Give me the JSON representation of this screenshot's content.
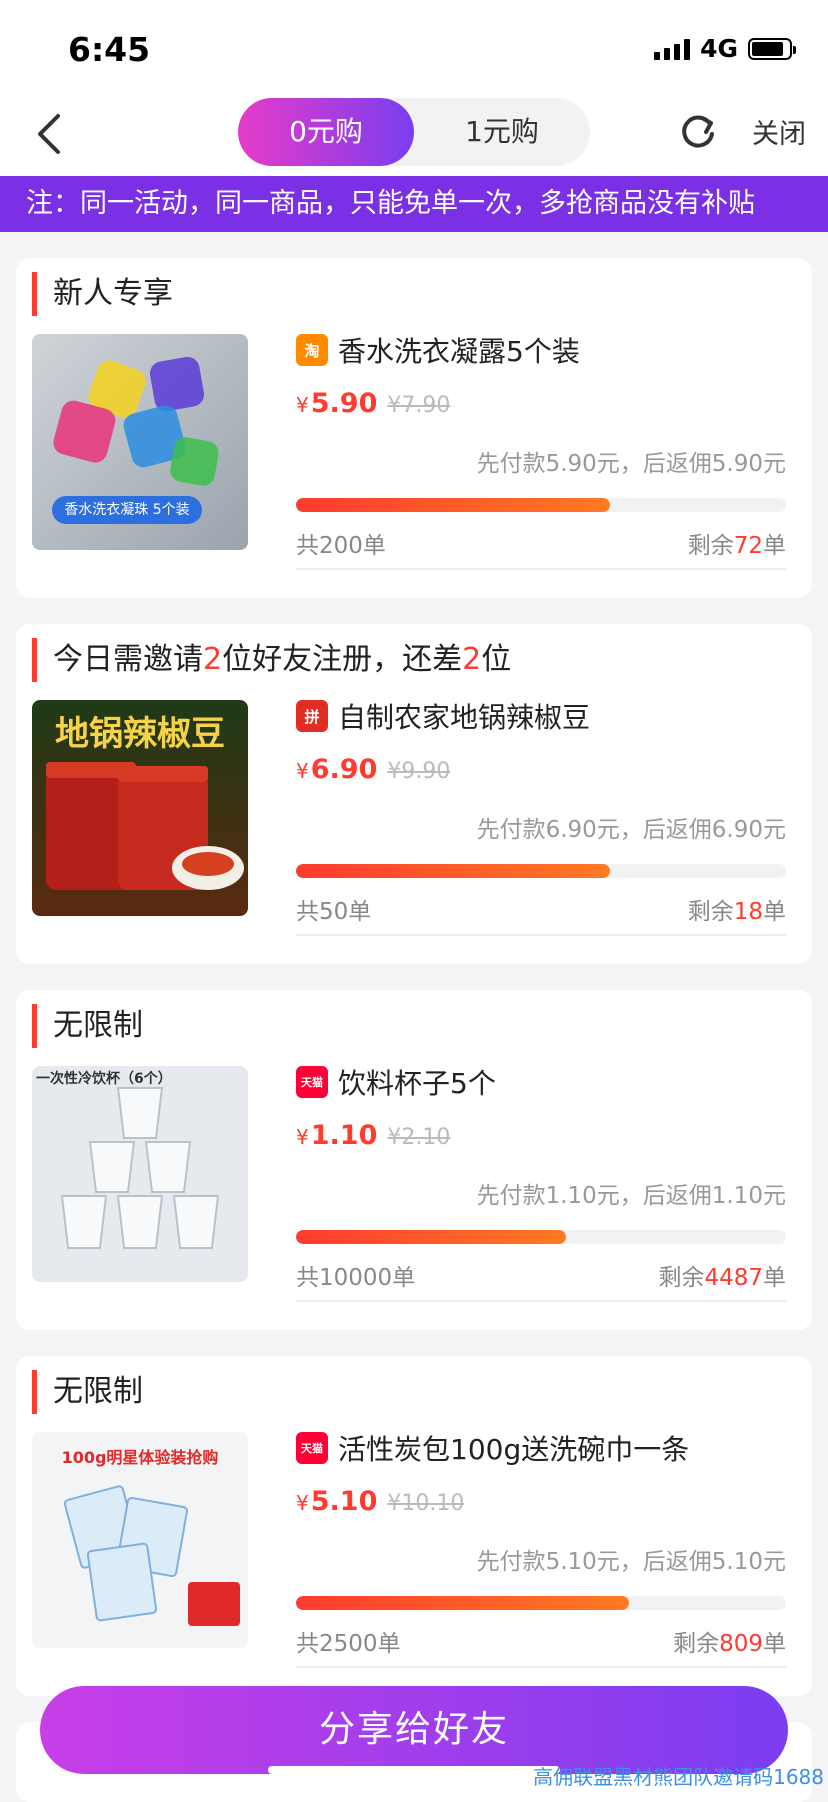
{
  "status_bar": {
    "time": "6:45",
    "network": "4G"
  },
  "nav": {
    "tabs": [
      {
        "label": "0元购",
        "active": true
      },
      {
        "label": "1元购",
        "active": false
      }
    ],
    "close_label": "关闭"
  },
  "notice": "注：同一活动，同一商品，只能免单一次，多抢商品没有补贴",
  "cards": [
    {
      "title": "新人专享",
      "platform_icon": "taobao-icon",
      "platform_text": "淘",
      "platform_color": "#ff8a00",
      "product": "香水洗衣凝露5个装",
      "image_label": "香水洗衣凝珠 5个装",
      "price_symbol": "¥",
      "price": "5.90",
      "original_price": "¥7.90",
      "rebate": "先付款5.90元，后返佣5.90元",
      "progress": 0.64,
      "total": "共200单",
      "remain_prefix": "剩余",
      "remain_num": "72",
      "remain_suffix": "单"
    },
    {
      "title_parts": [
        "今日需邀请",
        "2",
        "位好友注册，还差",
        "2",
        "位"
      ],
      "platform_icon": "pinduoduo-icon",
      "platform_text": "拼",
      "platform_color": "#e02e24",
      "product": "自制农家地锅辣椒豆",
      "image_label": "地锅辣椒豆",
      "price_symbol": "¥",
      "price": "6.90",
      "original_price": "¥9.90",
      "rebate": "先付款6.90元，后返佣6.90元",
      "progress": 0.64,
      "total": "共50单",
      "remain_prefix": "剩余",
      "remain_num": "18",
      "remain_suffix": "单"
    },
    {
      "title": "无限制",
      "platform_icon": "tmall-icon",
      "platform_text": "天猫",
      "platform_color": "#ff0036",
      "product": "饮料杯子5个",
      "image_label": "一次性冷饮杯（6个）",
      "price_symbol": "¥",
      "price": "1.10",
      "original_price": "¥2.10",
      "rebate": "先付款1.10元，后返佣1.10元",
      "progress": 0.55,
      "total": "共10000单",
      "remain_prefix": "剩余",
      "remain_num": "4487",
      "remain_suffix": "单"
    },
    {
      "title": "无限制",
      "platform_icon": "tmall-icon",
      "platform_text": "天猫",
      "platform_color": "#ff0036",
      "product": "活性炭包100g送洗碗巾一条",
      "image_label": "100g明星体验装抢购",
      "price_symbol": "¥",
      "price": "5.10",
      "original_price": "¥10.10",
      "rebate": "先付款5.10元，后返佣5.10元",
      "progress": 0.68,
      "total": "共2500单",
      "remain_prefix": "剩余",
      "remain_num": "809",
      "remain_suffix": "单"
    }
  ],
  "share_button": "分享给好友",
  "watermark": "高佣联盟黑材熊团队邀请码1688"
}
